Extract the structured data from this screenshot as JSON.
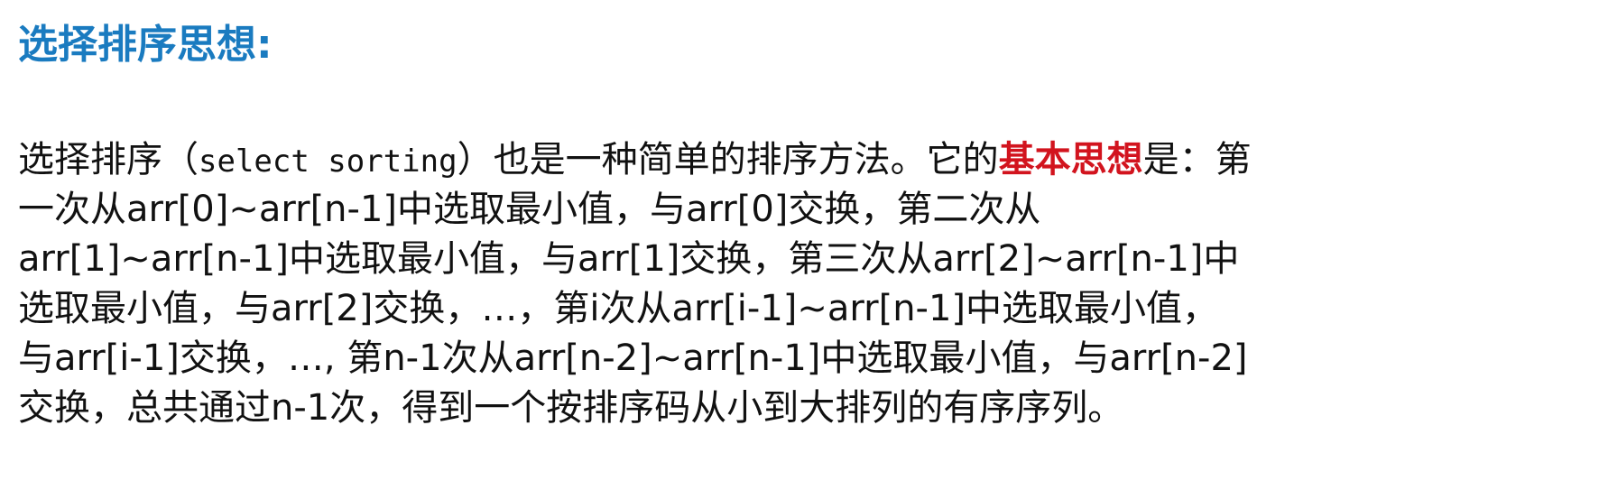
{
  "heading": {
    "text": "选择排序思想:",
    "color": "#1a7bc0"
  },
  "highlight_color": "#d2141e",
  "text_color": "#111111",
  "lines": [
    [
      {
        "text": "选择排序（"
      },
      {
        "text": "select sorting",
        "mono": true
      },
      {
        "text": "）也是一种简单的排序方法。它的"
      },
      {
        "text": "基本思想",
        "highlight": true
      },
      {
        "text": "是：第"
      }
    ],
    [
      {
        "text": "一次从arr[0]~arr[n-1]中选取最小值，与arr[0]交换，第二次从"
      }
    ],
    [
      {
        "text": "arr[1]~arr[n-1]中选取最小值，与arr[1]交换，第三次从arr[2]~arr[n-1]中"
      }
    ],
    [
      {
        "text": "选取最小值，与arr[2]交换，…，第i次从arr[i-1]~arr[n-1]中选取最小值，"
      }
    ],
    [
      {
        "text": "与arr[i-1]交换，…, 第n-1次从arr[n-2]~arr[n-1]中选取最小值，与arr[n-2]"
      }
    ],
    [
      {
        "text": "交换，总共通过n-1次，得到一个按排序码从小到大排列的有序序列。"
      }
    ]
  ]
}
